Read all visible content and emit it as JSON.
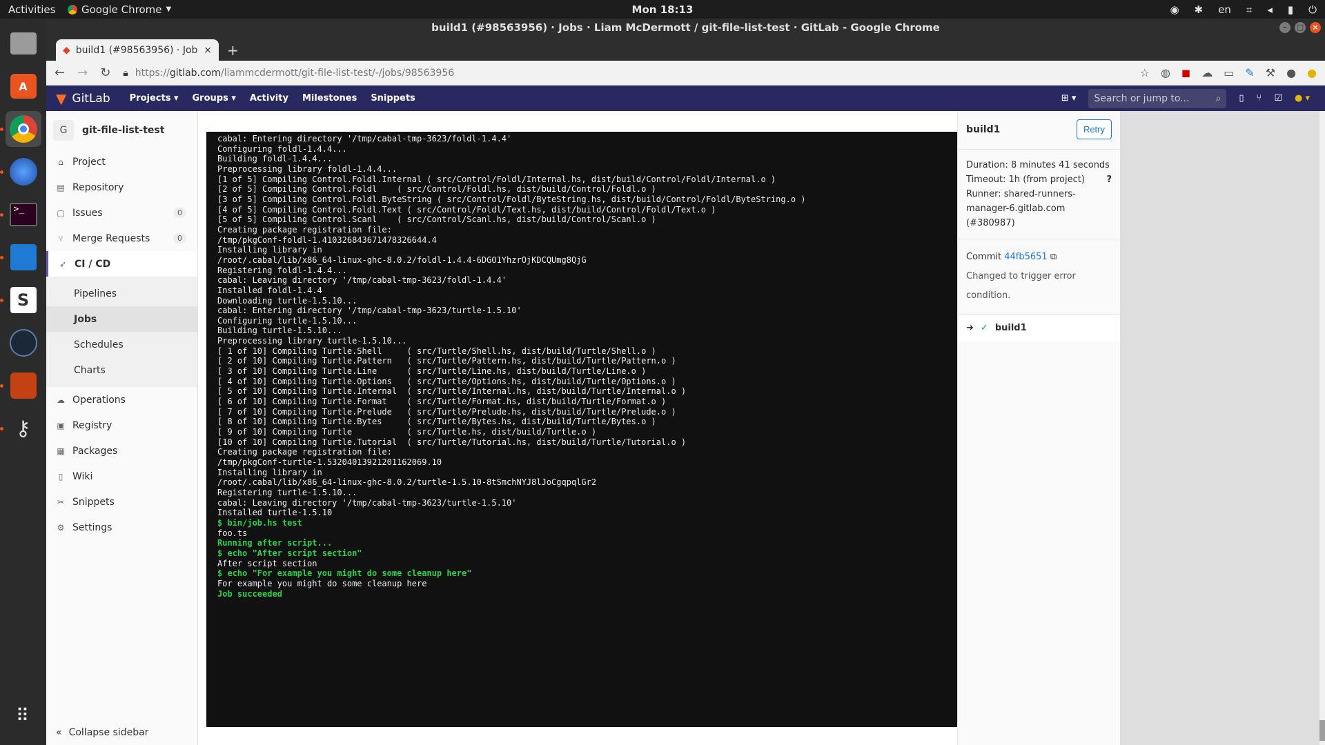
{
  "topbar": {
    "activities": "Activities",
    "app": "Google Chrome",
    "clock": "Mon 18:13",
    "lang": "en"
  },
  "window": {
    "title": "build1 (#98563956) · Jobs · Liam McDermott / git-file-list-test · GitLab - Google Chrome"
  },
  "tab": {
    "title": "build1 (#98563956) · Jobs"
  },
  "omnibox": {
    "scheme": "https://",
    "host": "gitlab.com",
    "path": "/liammcdermott/git-file-list-test/-/jobs/98563956"
  },
  "gitlab_header": {
    "logo": "GitLab",
    "nav": [
      "Projects",
      "Groups",
      "Activity",
      "Milestones",
      "Snippets"
    ],
    "search_placeholder": "Search or jump to..."
  },
  "sidebar": {
    "project_initial": "G",
    "project_name": "git-file-list-test",
    "items": [
      {
        "label": "Project",
        "icon": "home-icon"
      },
      {
        "label": "Repository",
        "icon": "doc-icon"
      },
      {
        "label": "Issues",
        "icon": "issues-icon",
        "badge": "0"
      },
      {
        "label": "Merge Requests",
        "icon": "merge-icon",
        "badge": "0"
      },
      {
        "label": "CI / CD",
        "icon": "rocket-icon"
      },
      {
        "label": "Operations",
        "icon": "cloud-icon"
      },
      {
        "label": "Registry",
        "icon": "box-icon"
      },
      {
        "label": "Packages",
        "icon": "package-icon"
      },
      {
        "label": "Wiki",
        "icon": "book-icon"
      },
      {
        "label": "Snippets",
        "icon": "scissors-icon"
      },
      {
        "label": "Settings",
        "icon": "gear-icon"
      }
    ],
    "cicd_sub": [
      "Pipelines",
      "Jobs",
      "Schedules",
      "Charts"
    ],
    "collapse": "Collapse sidebar"
  },
  "log_lines": [
    {
      "t": "cabal: Entering directory '/tmp/cabal-tmp-3623/foldl-1.4.4'",
      "g": false
    },
    {
      "t": "Configuring foldl-1.4.4...",
      "g": false
    },
    {
      "t": "Building foldl-1.4.4...",
      "g": false
    },
    {
      "t": "Preprocessing library foldl-1.4.4...",
      "g": false
    },
    {
      "t": "[1 of 5] Compiling Control.Foldl.Internal ( src/Control/Foldl/Internal.hs, dist/build/Control/Foldl/Internal.o )",
      "g": false
    },
    {
      "t": "[2 of 5] Compiling Control.Foldl    ( src/Control/Foldl.hs, dist/build/Control/Foldl.o )",
      "g": false
    },
    {
      "t": "[3 of 5] Compiling Control.Foldl.ByteString ( src/Control/Foldl/ByteString.hs, dist/build/Control/Foldl/ByteString.o )",
      "g": false
    },
    {
      "t": "[4 of 5] Compiling Control.Foldl.Text ( src/Control/Foldl/Text.hs, dist/build/Control/Foldl/Text.o )",
      "g": false
    },
    {
      "t": "[5 of 5] Compiling Control.Scanl    ( src/Control/Scanl.hs, dist/build/Control/Scanl.o )",
      "g": false
    },
    {
      "t": "Creating package registration file:",
      "g": false
    },
    {
      "t": "/tmp/pkgConf-foldl-1.4103268436714783​26644.4",
      "g": false
    },
    {
      "t": "Installing library in",
      "g": false
    },
    {
      "t": "/root/.cabal/lib/x86_64-linux-ghc-8.0.2/foldl-1.4.4-6DGO1YhzrOjKDCQUmg8QjG",
      "g": false
    },
    {
      "t": "Registering foldl-1.4.4...",
      "g": false
    },
    {
      "t": "cabal: Leaving directory '/tmp/cabal-tmp-3623/foldl-1.4.4'",
      "g": false
    },
    {
      "t": "Installed foldl-1.4.4",
      "g": false
    },
    {
      "t": "Downloading turtle-1.5.10...",
      "g": false
    },
    {
      "t": "cabal: Entering directory '/tmp/cabal-tmp-3623/turtle-1.5.10'",
      "g": false
    },
    {
      "t": "Configuring turtle-1.5.10...",
      "g": false
    },
    {
      "t": "Building turtle-1.5.10...",
      "g": false
    },
    {
      "t": "Preprocessing library turtle-1.5.10...",
      "g": false
    },
    {
      "t": "[ 1 of 10] Compiling Turtle.Shell     ( src/Turtle/Shell.hs, dist/build/Turtle/Shell.o )",
      "g": false
    },
    {
      "t": "[ 2 of 10] Compiling Turtle.Pattern   ( src/Turtle/Pattern.hs, dist/build/Turtle/Pattern.o )",
      "g": false
    },
    {
      "t": "[ 3 of 10] Compiling Turtle.Line      ( src/Turtle/Line.hs, dist/build/Turtle/Line.o )",
      "g": false
    },
    {
      "t": "[ 4 of 10] Compiling Turtle.Options   ( src/Turtle/Options.hs, dist/build/Turtle/Options.o )",
      "g": false
    },
    {
      "t": "[ 5 of 10] Compiling Turtle.Internal  ( src/Turtle/Internal.hs, dist/build/Turtle/Internal.o )",
      "g": false
    },
    {
      "t": "[ 6 of 10] Compiling Turtle.Format    ( src/Turtle/Format.hs, dist/build/Turtle/Format.o )",
      "g": false
    },
    {
      "t": "[ 7 of 10] Compiling Turtle.Prelude   ( src/Turtle/Prelude.hs, dist/build/Turtle/Prelude.o )",
      "g": false
    },
    {
      "t": "[ 8 of 10] Compiling Turtle.Bytes     ( src/Turtle/Bytes.hs, dist/build/Turtle/Bytes.o )",
      "g": false
    },
    {
      "t": "[ 9 of 10] Compiling Turtle           ( src/Turtle.hs, dist/build/Turtle.o )",
      "g": false
    },
    {
      "t": "[10 of 10] Compiling Turtle.Tutorial  ( src/Turtle/Tutorial.hs, dist/build/Turtle/Tutorial.o )",
      "g": false
    },
    {
      "t": "Creating package registration file:",
      "g": false
    },
    {
      "t": "/tmp/pkgConf-turtle-1.53204013921201162069.10",
      "g": false
    },
    {
      "t": "Installing library in",
      "g": false
    },
    {
      "t": "/root/.cabal/lib/x86_64-linux-ghc-8.0.2/turtle-1.5.10-8tSmchNYJ8lJoCgqpqlGr2",
      "g": false
    },
    {
      "t": "Registering turtle-1.5.10...",
      "g": false
    },
    {
      "t": "cabal: Leaving directory '/tmp/cabal-tmp-3623/turtle-1.5.10'",
      "g": false
    },
    {
      "t": "Installed turtle-1.5.10",
      "g": false
    },
    {
      "t": "$ bin/job.hs test",
      "g": true
    },
    {
      "t": "foo.ts",
      "g": false
    },
    {
      "t": "Running after script...",
      "g": true
    },
    {
      "t": "$ echo \"After script section\"",
      "g": true
    },
    {
      "t": "After script section",
      "g": false
    },
    {
      "t": "$ echo \"For example you might do some cleanup here\"",
      "g": true
    },
    {
      "t": "For example you might do some cleanup here",
      "g": false
    },
    {
      "t": "Job succeeded",
      "g": true
    }
  ],
  "job_panel": {
    "title": "build1",
    "retry": "Retry",
    "duration_label": "Duration:",
    "duration": "8 minutes 41 seconds",
    "timeout_label": "Timeout:",
    "timeout": "1h (from project)",
    "runner_label": "Runner:",
    "runner": "shared-runners-manager-6.gitlab.com (#380987)",
    "commit_label": "Commit",
    "commit_sha": "44fb5651",
    "commit_msg": "Changed to trigger error condition.",
    "job_name": "build1"
  }
}
